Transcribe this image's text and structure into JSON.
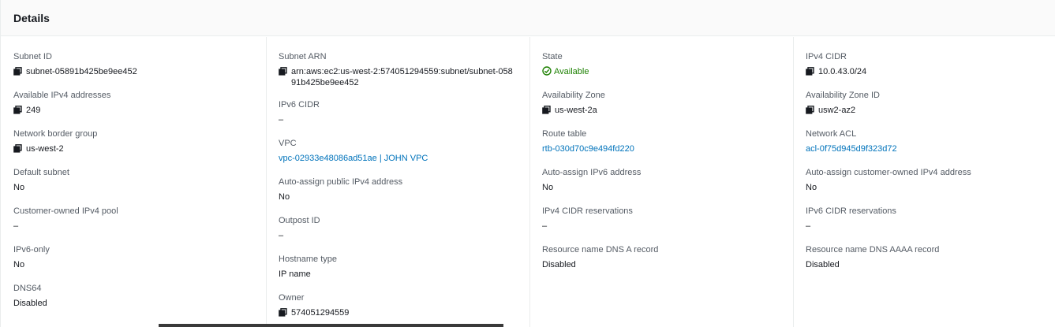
{
  "header": {
    "title": "Details"
  },
  "columns": [
    [
      {
        "label": "Subnet ID",
        "value": "subnet-05891b425be9ee452",
        "copy": true
      },
      {
        "label": "Available IPv4 addresses",
        "value": "249",
        "copy": true
      },
      {
        "label": "Network border group",
        "value": "us-west-2",
        "copy": true
      },
      {
        "label": "Default subnet",
        "value": "No"
      },
      {
        "label": "Customer-owned IPv4 pool",
        "value": "–"
      },
      {
        "label": "IPv6-only",
        "value": "No"
      },
      {
        "label": "DNS64",
        "value": "Disabled"
      }
    ],
    [
      {
        "label": "Subnet ARN",
        "value": "arn:aws:ec2:us-west-2:574051294559:subnet/subnet-05891b425be9ee452",
        "copy": true,
        "wrap": true
      },
      {
        "label": "IPv6 CIDR",
        "value": "–"
      },
      {
        "label": "VPC",
        "value": "vpc-02933e48086ad51ae | JOHN VPC",
        "link": true
      },
      {
        "label": "Auto-assign public IPv4 address",
        "value": "No"
      },
      {
        "label": "Outpost ID",
        "value": "–"
      },
      {
        "label": "Hostname type",
        "value": "IP name"
      },
      {
        "label": "Owner",
        "value": "574051294559",
        "copy": true
      }
    ],
    [
      {
        "label": "State",
        "value": "Available",
        "status": "ok"
      },
      {
        "label": "Availability Zone",
        "value": "us-west-2a",
        "copy": true
      },
      {
        "label": "Route table",
        "value": "rtb-030d70c9e494fd220",
        "link": true
      },
      {
        "label": "Auto-assign IPv6 address",
        "value": "No"
      },
      {
        "label": "IPv4 CIDR reservations",
        "value": "–"
      },
      {
        "label": "Resource name DNS A record",
        "value": "Disabled"
      }
    ],
    [
      {
        "label": "IPv4 CIDR",
        "value": "10.0.43.0/24",
        "copy": true
      },
      {
        "label": "Availability Zone ID",
        "value": "usw2-az2",
        "copy": true
      },
      {
        "label": "Network ACL",
        "value": "acl-0f75d945d9f323d72",
        "link": true
      },
      {
        "label": "Auto-assign customer-owned IPv4 address",
        "value": "No"
      },
      {
        "label": "IPv6 CIDR reservations",
        "value": "–"
      },
      {
        "label": "Resource name DNS AAAA record",
        "value": "Disabled"
      }
    ]
  ],
  "colors": {
    "link": "#0073bb",
    "success": "#1d8102",
    "label": "#545b64"
  },
  "icons": {
    "copy": "copy-icon",
    "status": "status-positive-icon"
  }
}
